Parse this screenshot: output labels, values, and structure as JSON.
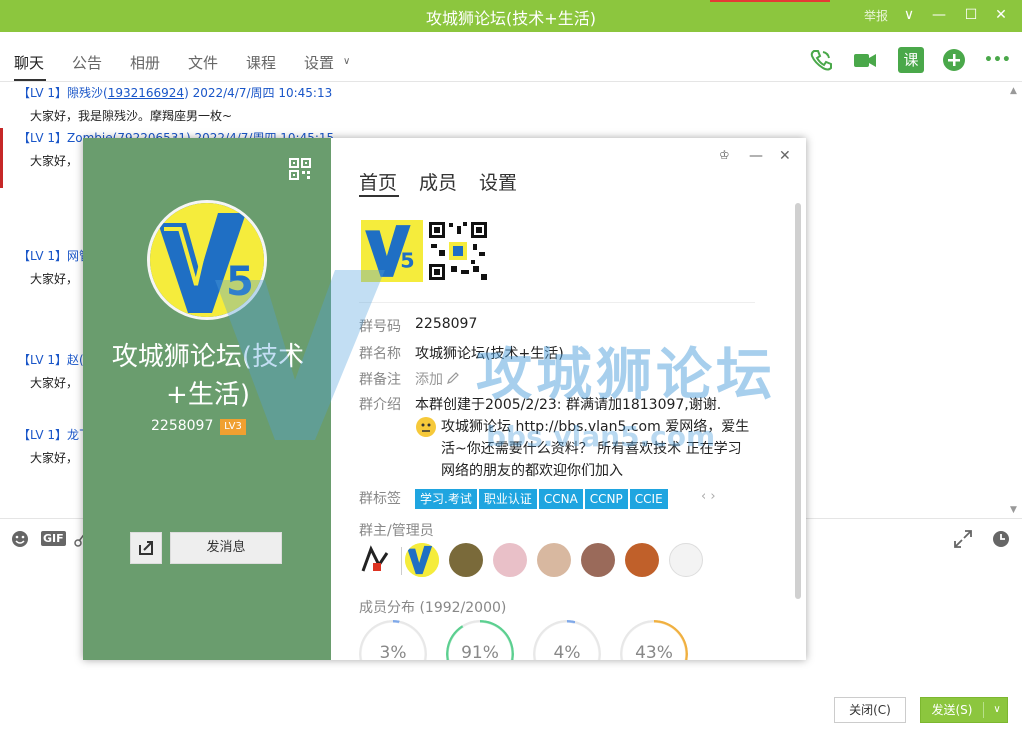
{
  "window": {
    "title": "攻城狮论坛(技术+生活)",
    "report_label": "举报",
    "chevron": "∨",
    "minimize": "—",
    "maximize": "☐",
    "close": "✕"
  },
  "tabs": [
    {
      "label": "聊天"
    },
    {
      "label": "公告"
    },
    {
      "label": "相册"
    },
    {
      "label": "文件"
    },
    {
      "label": "课程"
    },
    {
      "label": "设置"
    }
  ],
  "tab_dropdown": "∨",
  "toolbar_icons": [
    "phone-icon",
    "video-icon",
    "course-icon",
    "add-icon",
    "more-icon"
  ],
  "toolbar": {
    "course_label": "课",
    "more_label": "•••"
  },
  "messages": [
    {
      "level": "【LV 1】",
      "name": "隙残沙(",
      "id": "1932166924",
      "rest": ") 2022/4/7/周四 10:45:13",
      "body": "大家好，我是隙残沙。摩羯座男一枚~"
    },
    {
      "level": "【LV 1】",
      "name": "Zombie(",
      "id": "792206531",
      "rest": ") 2022/4/7/周四 10:45:15",
      "body": "大家好，"
    },
    {
      "level": "【LV 1】",
      "name": "网管",
      "id": "",
      "rest": "",
      "body": "大家好，"
    },
    {
      "level": "【LV 1】",
      "name": "赵(",
      "id": "",
      "rest": "",
      "body": "大家好，"
    },
    {
      "level": "【LV 1】",
      "name": "龙飞",
      "id": "",
      "rest": "",
      "body": "大家好，"
    }
  ],
  "input_toolbar": {
    "gif": "GIF"
  },
  "buttons": {
    "close": "关闭(C)",
    "send": "发送(S)",
    "send_caret": "∨"
  },
  "popup": {
    "group_name": "攻城狮论坛(技术+生活)",
    "group_number": "2258097",
    "level_badge": "LV3",
    "send_message": "发消息",
    "tabs": [
      "首页",
      "成员",
      "设置"
    ],
    "rows": {
      "number_label": "群号码",
      "number_value": "2258097",
      "name_label": "群名称",
      "name_value": "攻城狮论坛(技术+生活)",
      "remark_label": "群备注",
      "remark_value": "添加",
      "intro_label": "群介绍",
      "intro_text": "本群创建于2005/2/23:  群满请加1813097,谢谢.",
      "intro_text2": "攻城狮论坛   http://bbs.vlan5.com   爱网络，爱生活~你还需要什么资料？ 所有喜欢技术 正在学习网络的朋友的都欢迎你们加入",
      "tags_label": "群标签"
    },
    "tags": [
      "学习.考试",
      "职业认证",
      "CCNA",
      "CCNP",
      "CCIE"
    ],
    "tag_arrows": "‹  ›",
    "admins_label": "群主/管理员",
    "distribution_label": "成员分布 (1992/2000)",
    "distribution": [
      {
        "value": "3%",
        "fraction": 0.03,
        "color": "#7fa8e8"
      },
      {
        "value": "91%",
        "fraction": 0.91,
        "color": "#5ccf90"
      },
      {
        "value": "4%",
        "fraction": 0.04,
        "color": "#7fa8e8"
      },
      {
        "value": "43%",
        "fraction": 0.43,
        "color": "#f0b040"
      }
    ],
    "window_icons": {
      "skin": "♔",
      "minimize": "—",
      "close": "✕"
    }
  },
  "watermark": {
    "text": "攻城狮论坛",
    "url": "bbs.vlan5.com"
  },
  "colors": {
    "brand_green": "#8cc63e",
    "popup_left": "#6a9d6e",
    "tag_blue": "#1fa5e0",
    "link_blue": "#1a56c8"
  }
}
